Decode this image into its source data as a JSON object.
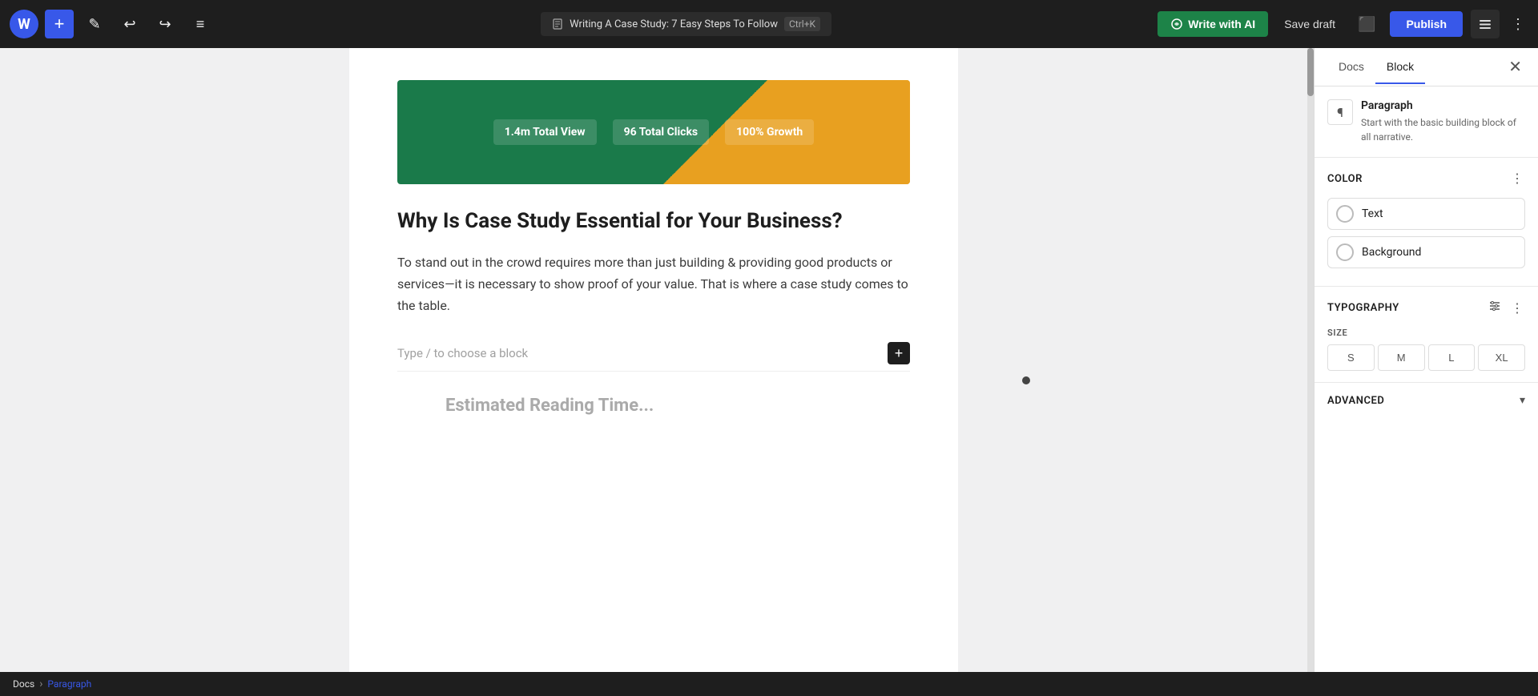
{
  "toolbar": {
    "wp_logo": "W",
    "add_label": "+",
    "edit_label": "✎",
    "undo_label": "↩",
    "redo_label": "↪",
    "list_label": "≡",
    "doc_title": "Writing A Case Study: 7 Easy Steps To Follow",
    "shortcut": "Ctrl+K",
    "write_ai_label": "Write with AI",
    "save_draft_label": "Save draft",
    "view_label": "⬜",
    "publish_label": "Publish",
    "settings_label": "⬛",
    "more_label": "⋮"
  },
  "panel": {
    "docs_tab": "Docs",
    "block_tab": "Block",
    "close_label": "✕",
    "block_icon": "¶",
    "block_name": "Paragraph",
    "block_desc": "Start with the basic building block of all narrative.",
    "color_section": "Color",
    "color_options_icon": "⋮",
    "text_label": "Text",
    "background_label": "Background",
    "typography_section": "Typography",
    "typography_options_icon": "⋮",
    "size_adjust_icon": "⇌",
    "size_label": "SIZE",
    "sizes": [
      "S",
      "M",
      "L",
      "XL"
    ],
    "advanced_section": "Advanced",
    "advanced_chevron": "▾"
  },
  "editor": {
    "heading": "Why Is Case Study Essential for Your Business?",
    "paragraph": "To stand out in the crowd requires more than just building & providing good products or services—it is necessary to show proof of your value. That is where a case study comes to the table.",
    "placeholder": "Type / to choose a block",
    "add_block_label": "+",
    "metrics": [
      {
        "val": "1.4m Total View",
        "label": ""
      },
      {
        "val": "96 Total Clicks",
        "label": ""
      },
      {
        "val": "100% Growth",
        "label": ""
      }
    ],
    "bottom_heading": "Estimated Reading Time..."
  },
  "breadcrumb": {
    "docs": "Docs",
    "separator": "›",
    "current": "Paragraph"
  }
}
